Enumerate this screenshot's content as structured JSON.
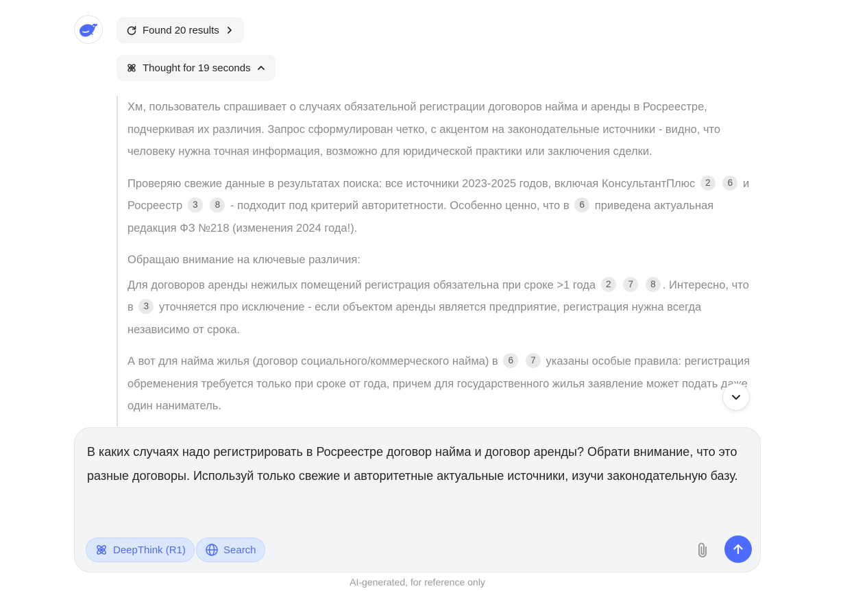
{
  "colors": {
    "accent": "#4d6bfe",
    "muted_text": "#8b8b8b",
    "chip_bg": "#dbe7fd"
  },
  "assistant": {
    "avatar_icon": "whale-logo-icon"
  },
  "search_results": {
    "label": "Found 20 results",
    "icon": "search-refresh-icon"
  },
  "thought": {
    "label": "Thought for 19 seconds",
    "icon": "atom-icon"
  },
  "thinking": {
    "p1": "Хм, пользователь спрашивает о случаях обязательной регистрации договоров найма и аренды в Росреестре, подчеркивая их различия. Запрос сформулирован четко, с акцентом на законодательные источники - видно, что человеку нужна точная информация, возможно для юридической практики или заключения сделки.",
    "p2": {
      "t1": "Проверяю свежие данные в результатах поиска: все источники 2023-2025 годов, включая КонсультантПлюс",
      "c1": "2",
      "c2": "6",
      "t2": "и Росреестр",
      "c3": "3",
      "c4": "8",
      "t3": "- подходит под критерий авторитетности. Особенно ценно, что в",
      "c5": "6",
      "t4": "приведена актуальная редакция ФЗ №218 (изменения 2024 года!)."
    },
    "p3": "Обращаю внимание на ключевые различия:",
    "p4": {
      "t1": "Для договоров аренды нежилых помещений регистрация обязательна при сроке >1 года",
      "c1": "2",
      "c2": "7",
      "c3": "8",
      "t2": ". Интересно, что в",
      "c4": "3",
      "t3": "уточняется про исключение - если объектом аренды является предприятие, регистрация нужна всегда независимо от срока."
    },
    "p5": {
      "t1": "А вот для найма жилья (договор социального/коммерческого найма) в",
      "c1": "6",
      "c2": "7",
      "t2": "указаны особые правила: регистрация обременения требуется только при сроке от года, причем для государственного жилья заявление может подать даже один наниматель."
    }
  },
  "composer": {
    "text": "В каких случаях надо регистрировать в Росреестре договор найма и договор аренды? Обрати внимание, что это разные договоры. Используй только свежие и авторитетные актуальные источники, изучи законодательную базу.",
    "deepthink_label": "DeepThink (R1)",
    "search_label": "Search"
  },
  "footer": {
    "note": "AI-generated, for reference only"
  }
}
